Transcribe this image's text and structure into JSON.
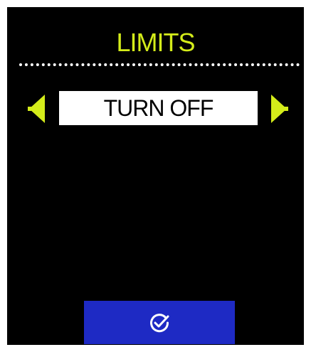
{
  "screen": {
    "title": "LIMITS",
    "accent_color": "#d4ec1a",
    "background_color": "#000000"
  },
  "selector": {
    "value": "TURN OFF",
    "prev_icon": "triangle-left-icon",
    "next_icon": "triangle-right-icon"
  },
  "confirm": {
    "icon": "check-circle-icon",
    "color": "#1e2ac4"
  }
}
